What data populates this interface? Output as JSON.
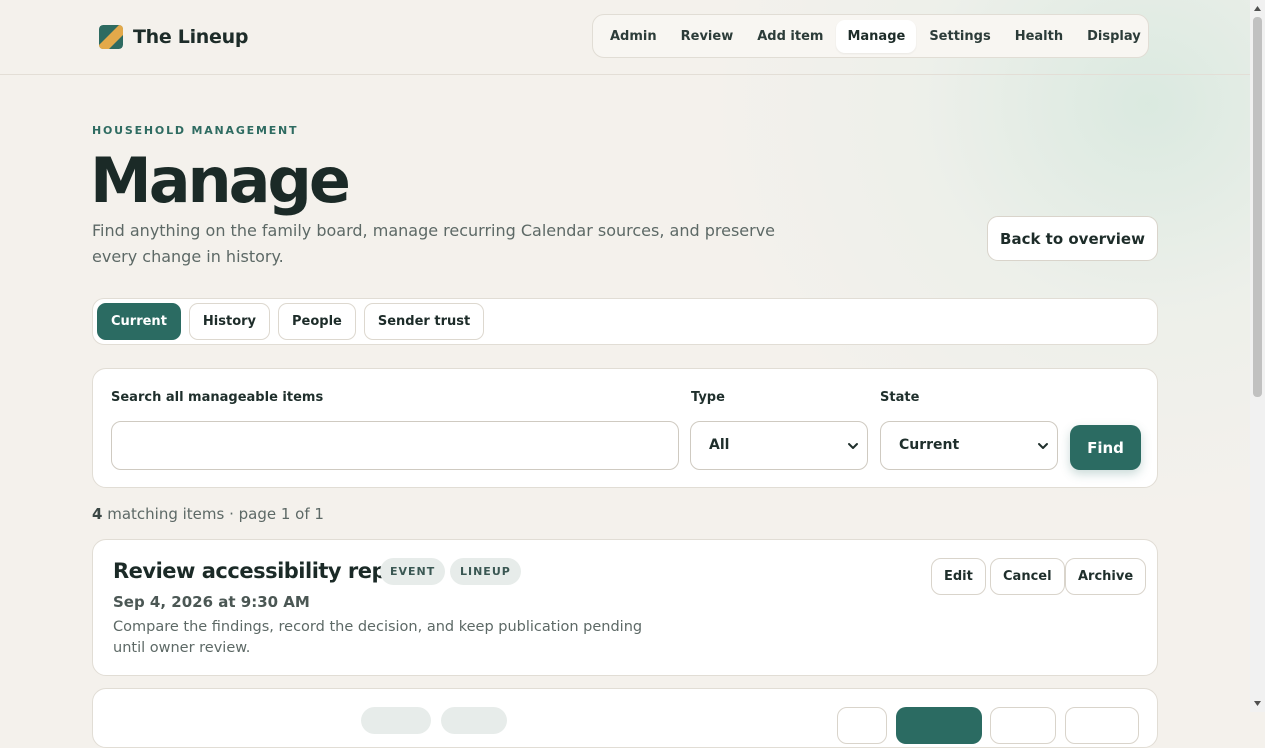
{
  "brand": {
    "name": "The Lineup",
    "logo_colors": [
      "#2e6b61",
      "#e3a94a"
    ]
  },
  "topnav": {
    "items": [
      {
        "label": "Admin",
        "active": false
      },
      {
        "label": "Review",
        "active": false
      },
      {
        "label": "Add item",
        "active": false
      },
      {
        "label": "Manage",
        "active": true
      },
      {
        "label": "Settings",
        "active": false
      },
      {
        "label": "Health",
        "active": false
      },
      {
        "label": "Display",
        "active": false
      }
    ]
  },
  "header": {
    "eyebrow": "HOUSEHOLD MANAGEMENT",
    "title": "Manage",
    "description": "Find anything on the family board, manage recurring Calendar sources, and preserve every change in history.",
    "back_label": "Back to overview"
  },
  "tabs": [
    {
      "label": "Current",
      "active": true
    },
    {
      "label": "History",
      "active": false
    },
    {
      "label": "People",
      "active": false
    },
    {
      "label": "Sender trust",
      "active": false
    }
  ],
  "search": {
    "search_label": "Search all manageable items",
    "search_value": "",
    "type_label": "Type",
    "type_value": "All",
    "state_label": "State",
    "state_value": "Current",
    "find_label": "Find"
  },
  "results": {
    "count": "4",
    "summary": "matching items · page 1 of 1"
  },
  "items": [
    {
      "title": "Review accessibility report",
      "badges": [
        "EVENT",
        "LINEUP"
      ],
      "date": "Sep 4, 2026 at 9:30 AM",
      "description": "Compare the findings, record the decision, and keep publication pending until owner review.",
      "actions": [
        "Edit",
        "Cancel",
        "Archive"
      ]
    }
  ],
  "colors": {
    "accent": "#2b6b62",
    "background": "#f4f1ec",
    "surface": "#ffffff"
  }
}
